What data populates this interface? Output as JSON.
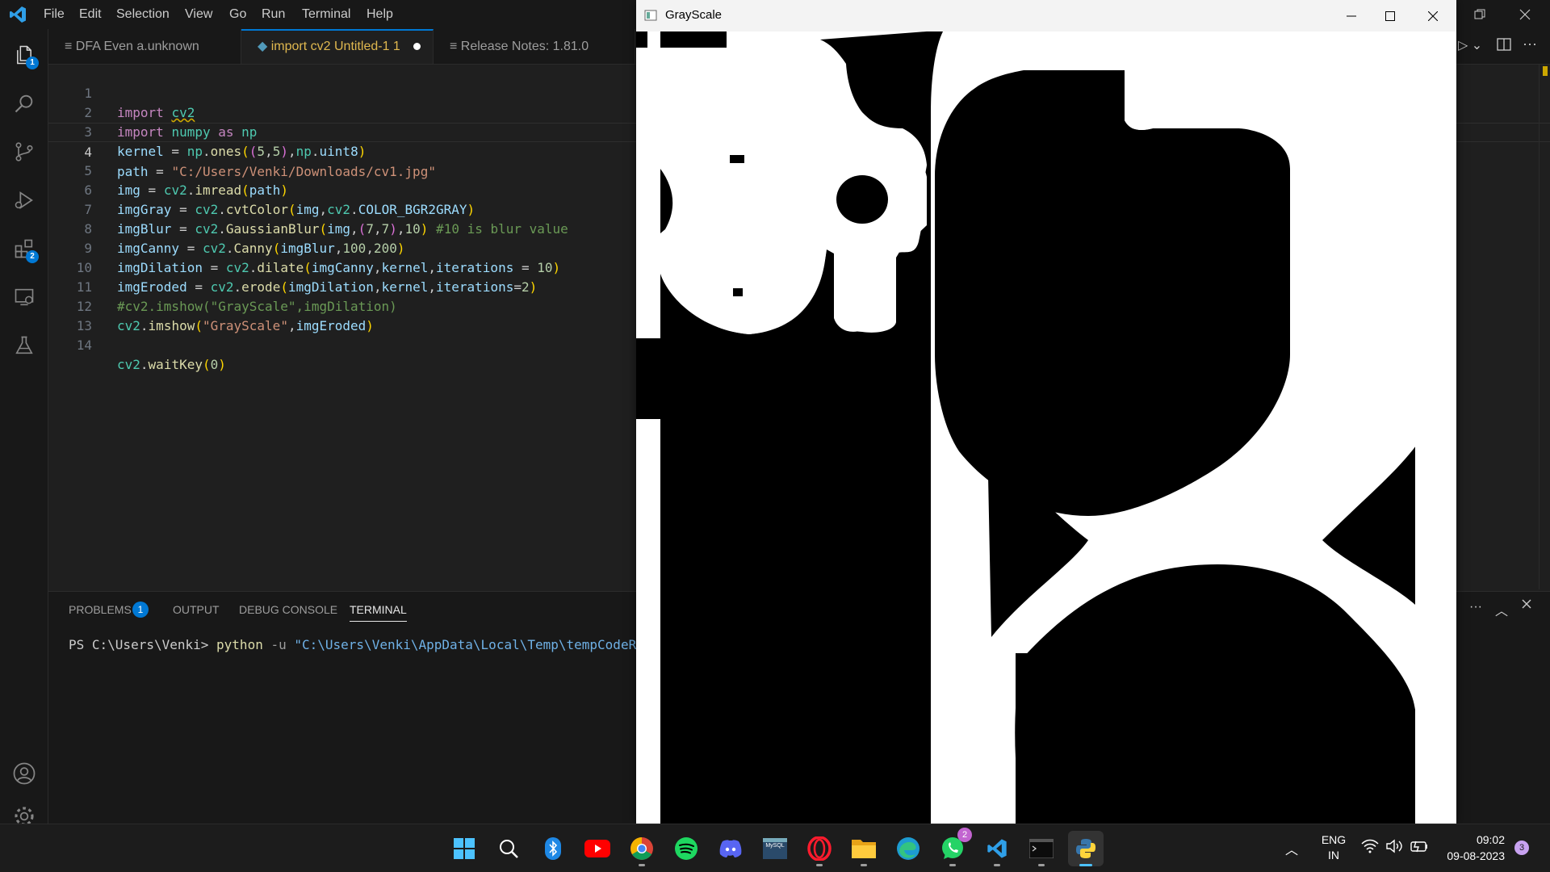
{
  "vscode": {
    "menu": [
      "File",
      "Edit",
      "Selection",
      "View",
      "Go",
      "Run",
      "Terminal",
      "Help"
    ],
    "activity_badges": {
      "explorer": "1",
      "extensions": "2"
    },
    "tabs": [
      {
        "label": "DFA  Even  a.unknown",
        "icon": "list-icon"
      },
      {
        "label": "import cv2  Untitled-1 1",
        "icon": "python-icon",
        "modified": true
      },
      {
        "label": "Release Notes: 1.81.0",
        "icon": "list-icon"
      }
    ],
    "line_numbers": [
      "1",
      "2",
      "3",
      "4",
      "5",
      "6",
      "7",
      "8",
      "9",
      "10",
      "11",
      "12",
      "13",
      "14"
    ],
    "code": {
      "l1a": "import ",
      "l1b": "cv2",
      "l2a": "import ",
      "l2b": "numpy",
      "l2c": " as ",
      "l2d": "np",
      "l3a": "kernel",
      " l3b": "",
      "l3": [
        "kernel",
        " = ",
        "np",
        ".",
        "ones",
        "(",
        "(",
        "5",
        ",",
        "5",
        ")",
        ",",
        "np",
        ".",
        "uint8",
        ")"
      ],
      "l4": [
        "path",
        " = ",
        "\"C:/Users/Venki/Downloads/cv1.jpg\""
      ],
      "l5": [
        "img",
        " = ",
        "cv2",
        ".",
        "imread",
        "(",
        "path",
        ")"
      ],
      "l6": [
        "imgGray",
        " = ",
        "cv2",
        ".",
        "cvtColor",
        "(",
        "img",
        ",",
        "cv2",
        ".",
        "COLOR_BGR2GRAY",
        ")"
      ],
      "l7": [
        "imgBlur",
        " = ",
        "cv2",
        ".",
        "GaussianBlur",
        "(",
        "img",
        ",",
        "(",
        "7",
        ",",
        "7",
        ")",
        ",",
        "10",
        ")",
        " #10 is blur value"
      ],
      "l8": [
        "imgCanny",
        " = ",
        "cv2",
        ".",
        "Canny",
        "(",
        "imgBlur",
        ",",
        "100",
        ",",
        "200",
        ")"
      ],
      "l9": [
        "imgDilation",
        " = ",
        "cv2",
        ".",
        "dilate",
        "(",
        "imgCanny",
        ",",
        "kernel",
        ",",
        "iterations",
        " = ",
        "10",
        ")"
      ],
      "l10": [
        "imgEroded",
        " = ",
        "cv2",
        ".",
        "erode",
        "(",
        "imgDilation",
        ",",
        "kernel",
        ",",
        "iterations",
        "=",
        "2",
        ")"
      ],
      "l11": "#cv2.imshow(\"GrayScale\",imgDilation)",
      "l12": [
        "cv2",
        ".",
        "imshow",
        "(",
        "\"GrayScale\"",
        ",",
        "imgEroded",
        ")"
      ],
      "l14": [
        "cv2",
        ".",
        "waitKey",
        "(",
        "0",
        ")"
      ]
    },
    "panel": {
      "tabs": [
        "PROBLEMS",
        "OUTPUT",
        "DEBUG CONSOLE",
        "TERMINAL"
      ],
      "problems_count": "1",
      "terminal_prompt": "PS C:\\Users\\Venki> ",
      "terminal_cmd": "python",
      "terminal_flag": " -u ",
      "terminal_arg": "\"C:\\Users\\Venki\\AppData\\Local\\Temp\\tempCodeRunner"
    }
  },
  "gray_window": {
    "title": "GrayScale"
  },
  "taskbar": {
    "lang_top": "ENG",
    "lang_bottom": "IN",
    "time": "09:02",
    "date": "09-08-2023",
    "notif_count": "3",
    "whatsapp_badge": "2",
    "mysql_label": "MySQL"
  }
}
